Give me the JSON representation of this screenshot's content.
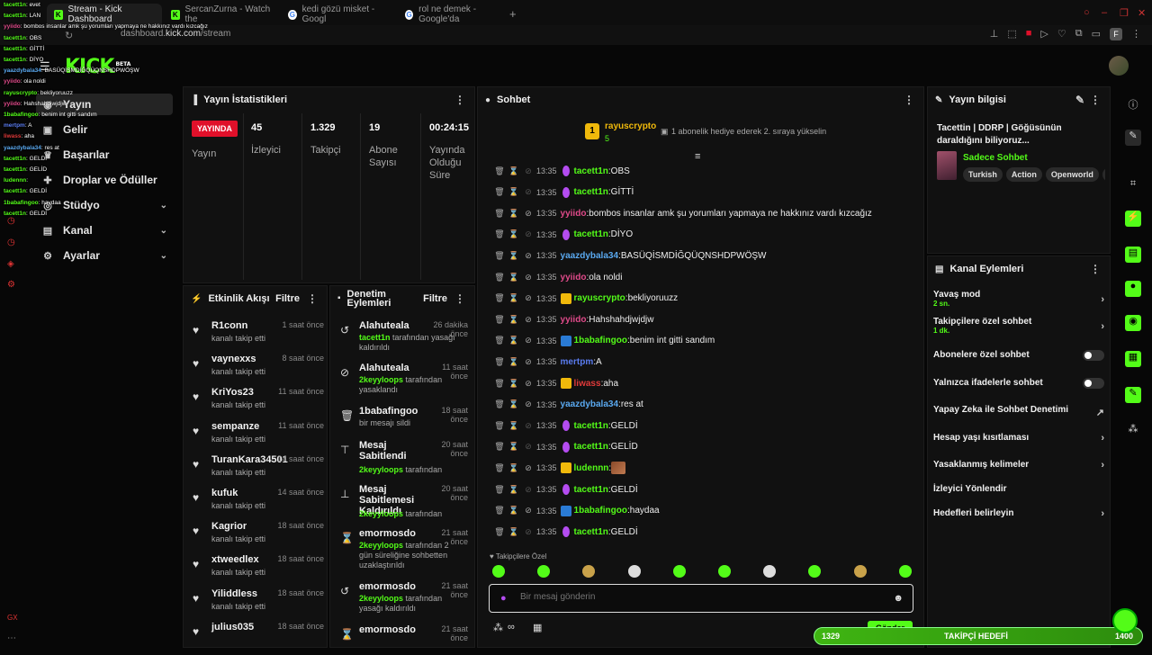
{
  "browser": {
    "tabs": [
      {
        "label": "Stream - Kick Dashboard",
        "icon": "kick-favicon",
        "active": true
      },
      {
        "label": "SercanZurna - Watch the",
        "icon": "kick-favicon",
        "active": false
      },
      {
        "label": "kedi gözü misket - Googl",
        "icon": "google-favicon",
        "active": false
      },
      {
        "label": "rol ne demek - Google'da",
        "icon": "google-favicon",
        "active": false
      }
    ],
    "url_prefix": "dashboard.",
    "url_domain": "kick.com",
    "url_path": "/stream",
    "profile_letter": "F"
  },
  "logo": {
    "text": "KICK",
    "beta": "BETA"
  },
  "nav": {
    "items": [
      {
        "label": "Yayın",
        "icon": "broadcast-icon",
        "selected": true
      },
      {
        "label": "Gelir",
        "icon": "money-icon"
      },
      {
        "label": "Başarılar",
        "icon": "trophy-icon"
      },
      {
        "label": "Droplar ve Ödüller",
        "icon": "gift-icon"
      },
      {
        "label": "Stüdyo",
        "icon": "studio-icon",
        "expandable": true
      },
      {
        "label": "Kanal",
        "icon": "channel-icon",
        "expandable": true
      },
      {
        "label": "Ayarlar",
        "icon": "gear-icon",
        "expandable": true
      }
    ]
  },
  "overlay_chat": [
    {
      "user": "tacett1n",
      "msg": "evet"
    },
    {
      "user": "tacett1n",
      "msg": "LAN"
    },
    {
      "user": "yyiido",
      "msg": "bombos insanlar amk şu yorumları yapmaya ne hakkınız vardı kızcağız"
    },
    {
      "user": "tacett1n",
      "msg": "OBS"
    },
    {
      "user": "tacett1n",
      "msg": "GİTTİ"
    },
    {
      "user": "tacett1n",
      "msg": "DİYO"
    },
    {
      "user": "yaazdybala34",
      "msg": "BASÜQİSMDİĞQÜQNSHDPWÖŞW"
    },
    {
      "user": "yyiido",
      "msg": "ola noldi"
    },
    {
      "user": "rayuscrypto",
      "msg": "bekliyoruuzz"
    },
    {
      "user": "yyiido",
      "msg": "Hahshahdjwjdjw"
    },
    {
      "user": "1babafingoo",
      "msg": "benim int gitti sandım"
    },
    {
      "user": "mertpm",
      "msg": "A"
    },
    {
      "user": "liwass",
      "msg": "aha"
    },
    {
      "user": "yaazdybala34",
      "msg": "res at"
    },
    {
      "user": "tacett1n",
      "msg": "GELDİ"
    },
    {
      "user": "tacett1n",
      "msg": "GELİD"
    },
    {
      "user": "ludennn",
      "msg": ""
    },
    {
      "user": "tacett1n",
      "msg": "GELDİ"
    },
    {
      "user": "1babafingoo",
      "msg": "haydaa"
    },
    {
      "user": "tacett1n",
      "msg": "GELDİ"
    }
  ],
  "stats": {
    "title": "Yayın İstatistikleri",
    "live_badge": "YAYINDA",
    "live_label": "Yayın",
    "viewers_value": "45",
    "viewers_label": "İzleyici",
    "followers_value": "1.329",
    "followers_label": "Takipçi",
    "subs_value": "19",
    "subs_label": "Abone Sayısı",
    "uptime_value": "00:24:15",
    "uptime_label": "Yayında Olduğu Süre"
  },
  "activity": {
    "title": "Etkinlik Akışı",
    "filter": "Filtre",
    "items": [
      {
        "name": "R1conn",
        "time": "1 saat önce",
        "desc": "kanalı takip etti"
      },
      {
        "name": "vaynexxs",
        "time": "8 saat önce",
        "desc": "kanalı takip etti"
      },
      {
        "name": "KriYos23",
        "time": "11 saat önce",
        "desc": "kanalı takip etti"
      },
      {
        "name": "sempanze",
        "time": "11 saat önce",
        "desc": "kanalı takip etti"
      },
      {
        "name": "TuranKara34501",
        "time": "14 saat önce",
        "desc": "kanalı takip etti"
      },
      {
        "name": "kufuk",
        "time": "14 saat önce",
        "desc": "kanalı takip etti"
      },
      {
        "name": "Kagrior",
        "time": "18 saat önce",
        "desc": "kanalı takip etti"
      },
      {
        "name": "xtweedlex",
        "time": "18 saat önce",
        "desc": "kanalı takip etti"
      },
      {
        "name": "Yiliddless",
        "time": "18 saat önce",
        "desc": "kanalı takip etti"
      },
      {
        "name": "julius035",
        "time": "18 saat önce",
        "desc": ""
      }
    ]
  },
  "moderation": {
    "title": "Denetim Eylemleri",
    "filter": "Filtre",
    "items": [
      {
        "name": "Alahuteala",
        "time": "26 dakika önce",
        "actor": "tacett1n",
        "desc": "tarafından yasağı kaldırıldı",
        "icon": "undo-icon"
      },
      {
        "name": "Alahuteala",
        "time": "11 saat önce",
        "actor": "2keyyloops",
        "desc": "tarafından yasaklandı",
        "icon": "ban-icon"
      },
      {
        "name": "1babafingoo",
        "time": "18 saat önce",
        "actor": "",
        "desc": "bir mesajı sildi",
        "icon": "trash-icon"
      },
      {
        "name": "Mesaj Sabitlendi",
        "time": "20 saat önce",
        "actor": "2keyyloops",
        "desc": "tarafından",
        "icon": "pin-icon"
      },
      {
        "name": "Mesaj Sabitlemesi Kaldırıldı",
        "time": "20 saat önce",
        "actor": "2keyyloops",
        "desc": "tarafından",
        "icon": "unpin-icon"
      },
      {
        "name": "emormosdo",
        "time": "21 saat önce",
        "actor": "2keyyloops",
        "desc": "tarafından 2 gün süreliğine sohbetten uzaklaştırıldı",
        "icon": "hourglass-icon"
      },
      {
        "name": "emormosdo",
        "time": "21 saat önce",
        "actor": "2keyyloops",
        "desc": "tarafından yasağı kaldırıldı",
        "icon": "undo-icon"
      },
      {
        "name": "emormosdo",
        "time": "21 saat önce",
        "actor": "",
        "desc": "",
        "icon": "hourglass-icon"
      }
    ]
  },
  "chat": {
    "title": "Sohbet",
    "pinned_user": "rayuscrypto",
    "pinned_count": "5",
    "pinned_rank": "1",
    "pinned_msg": "1 abonelik hediye ederek 2. sıraya yükselin",
    "messages": [
      {
        "time": "13:35",
        "user": "tacett1n",
        "color": "#53fc18",
        "msg": "OBS",
        "badge": "mic"
      },
      {
        "time": "13:35",
        "user": "tacett1n",
        "color": "#53fc18",
        "msg": "GİTTİ",
        "badge": "mic"
      },
      {
        "time": "13:35",
        "user": "yyiido",
        "color": "#e04a8a",
        "msg": "bombos insanlar amk şu yorumları yapmaya ne hakkınız vardı kızcağız",
        "badge": ""
      },
      {
        "time": "13:35",
        "user": "tacett1n",
        "color": "#53fc18",
        "msg": "DİYO",
        "badge": "mic"
      },
      {
        "time": "13:35",
        "user": "yaazdybala34",
        "color": "#5aa9f0",
        "msg": "BASÜQİSMDİĞQÜQNSHDPWÖŞW",
        "badge": ""
      },
      {
        "time": "13:35",
        "user": "yyiido",
        "color": "#e04a8a",
        "msg": "ola noldi",
        "badge": ""
      },
      {
        "time": "13:35",
        "user": "rayuscrypto",
        "color": "#53fc18",
        "msg": "bekliyoruuzz",
        "badge": "crown"
      },
      {
        "time": "13:35",
        "user": "yyiido",
        "color": "#e04a8a",
        "msg": "Hahshahdjwjdjw",
        "badge": ""
      },
      {
        "time": "13:35",
        "user": "1babafingoo",
        "color": "#53fc18",
        "msg": "benim int gitti sandım",
        "badge": "sword"
      },
      {
        "time": "13:35",
        "user": "mertpm",
        "color": "#5a7cf0",
        "msg": "A",
        "badge": ""
      },
      {
        "time": "13:35",
        "user": "liwass",
        "color": "#e03a3a",
        "msg": "aha",
        "badge": "crown"
      },
      {
        "time": "13:35",
        "user": "yaazdybala34",
        "color": "#5aa9f0",
        "msg": "res at",
        "badge": ""
      },
      {
        "time": "13:35",
        "user": "tacett1n",
        "color": "#53fc18",
        "msg": "GELDİ",
        "badge": "mic"
      },
      {
        "time": "13:35",
        "user": "tacett1n",
        "color": "#53fc18",
        "msg": "GELİD",
        "badge": "mic"
      },
      {
        "time": "13:35",
        "user": "ludennn",
        "color": "#53fc18",
        "msg": "",
        "badge": "crown"
      },
      {
        "time": "13:35",
        "user": "tacett1n",
        "color": "#53fc18",
        "msg": "GELDİ",
        "badge": "mic"
      },
      {
        "time": "13:35",
        "user": "1babafingoo",
        "color": "#53fc18",
        "msg": "haydaa",
        "badge": "sword"
      },
      {
        "time": "13:35",
        "user": "tacett1n",
        "color": "#53fc18",
        "msg": "GELDİ",
        "badge": "mic"
      }
    ],
    "followers_only": "Takipçilere Özel",
    "input_placeholder": "Bir mesaj gönderin",
    "send_label": "Gönder"
  },
  "stream_info": {
    "title": "Yayın bilgisi",
    "stream_title": "Tacettin | DDRP | Göğüsünün daraldığını biliyoruz...",
    "category": "Sadece Sohbet",
    "tags": [
      "Turkish",
      "Action",
      "Openworld",
      "S"
    ]
  },
  "channel_actions": {
    "title": "Kanal Eylemleri",
    "items": [
      {
        "label": "Yavaş mod",
        "sub": "2 sn.",
        "control": "chevron"
      },
      {
        "label": "Takipçilere özel sohbet",
        "sub": "1 dk.",
        "control": "chevron"
      },
      {
        "label": "Abonelere özel sohbet",
        "sub": "",
        "control": "toggle"
      },
      {
        "label": "Yalnızca ifadelerle sohbet",
        "sub": "",
        "control": "toggle"
      },
      {
        "label": "Yapay Zeka ile Sohbet Denetimi",
        "sub": "",
        "control": "external"
      },
      {
        "label": "Hesap yaşı kısıtlaması",
        "sub": "",
        "control": "chevron"
      },
      {
        "label": "Yasaklanmış kelimeler",
        "sub": "",
        "control": "chevron"
      },
      {
        "label": "İzleyici Yönlendir",
        "sub": "",
        "control": "none"
      },
      {
        "label": "Hedefleri belirleyin",
        "sub": "",
        "control": "chevron"
      }
    ]
  },
  "goal": {
    "current": "1329",
    "label": "TAKİPÇİ HEDEFİ",
    "target": "1400"
  },
  "colors": {
    "accent": "#53fc18",
    "live": "#e0102a",
    "bg": "#070707",
    "panel": "#111111"
  }
}
